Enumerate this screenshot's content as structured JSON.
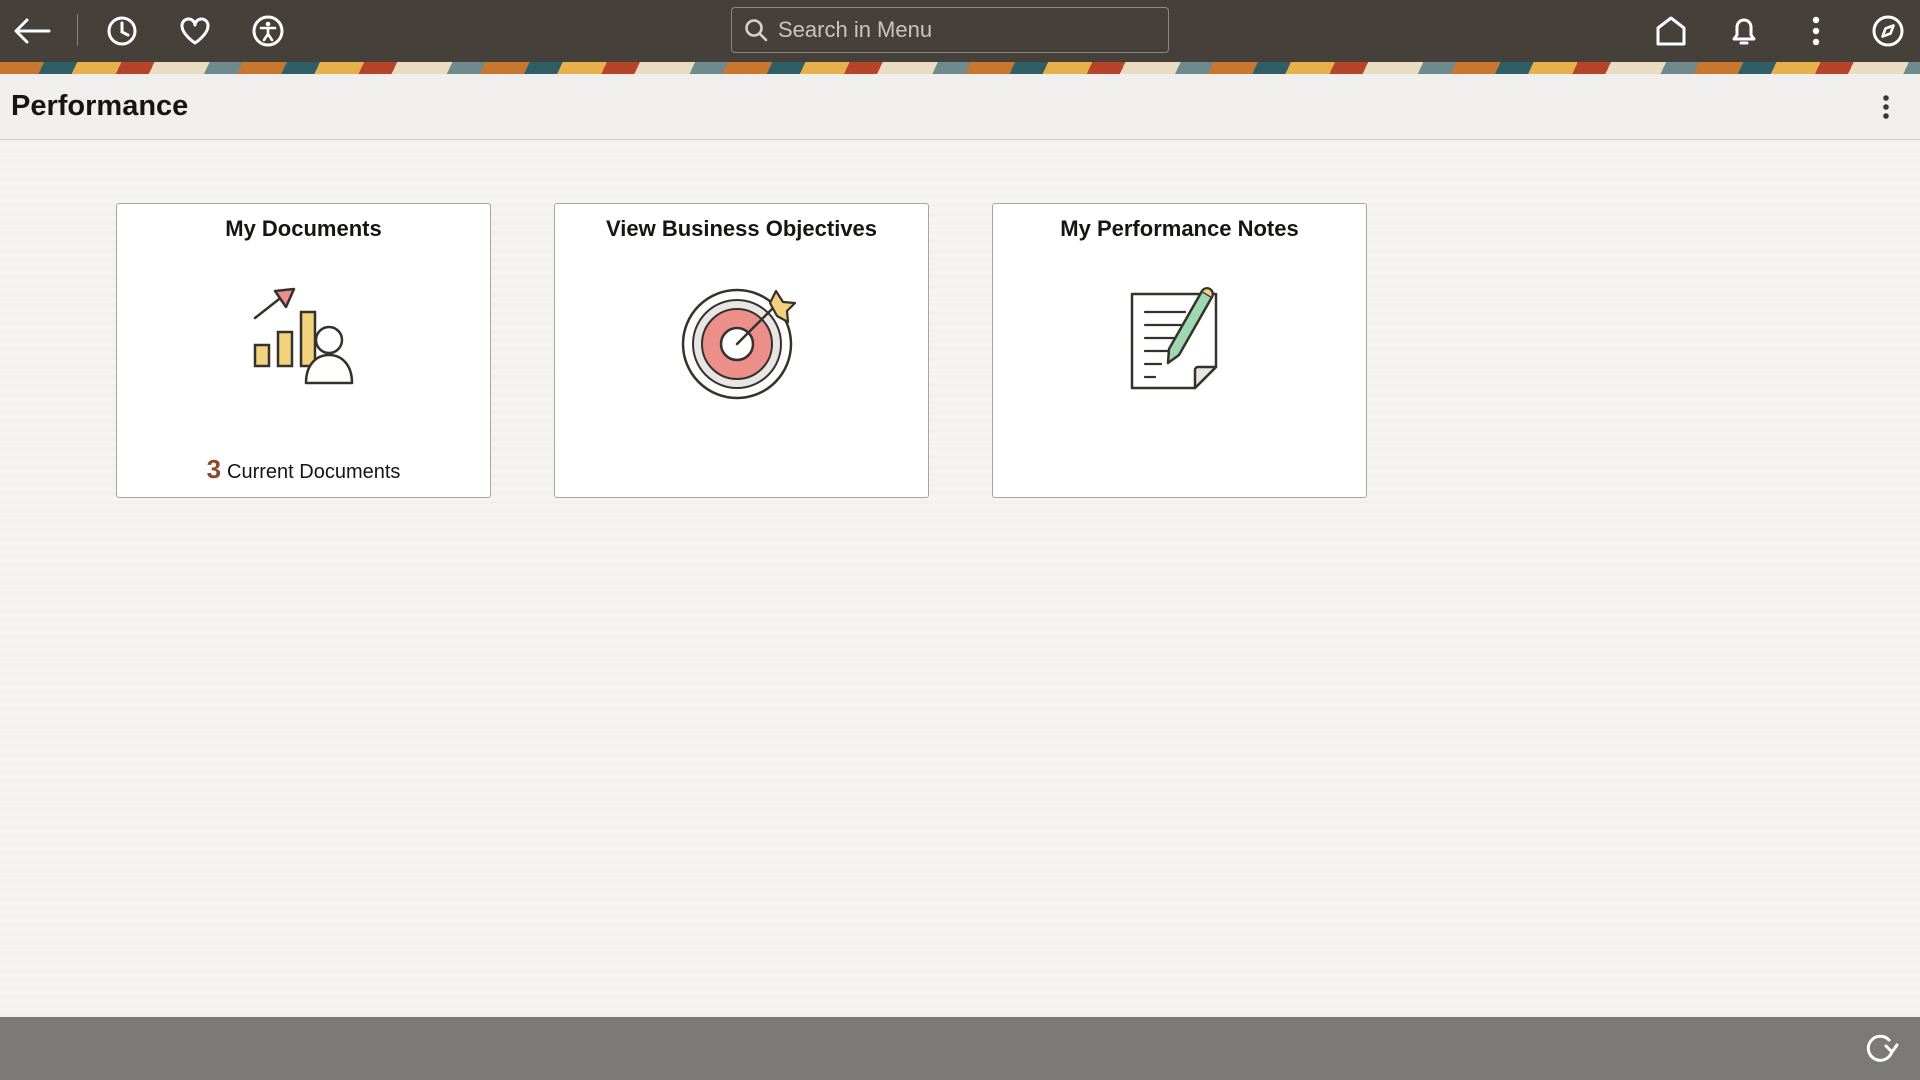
{
  "topbar": {
    "icons": [
      "back-arrow-icon",
      "recent-history-icon",
      "favorites-heart-icon",
      "accessibility-icon",
      "home-icon",
      "notifications-bell-icon",
      "more-actions-icon",
      "navigator-compass-icon"
    ],
    "search": {
      "placeholder": "Search in Menu",
      "value": ""
    }
  },
  "page": {
    "title": "Performance"
  },
  "tiles": [
    {
      "title": "My Documents",
      "count": "3",
      "footer_label": "Current Documents",
      "icon": "performance-chart-person-icon"
    },
    {
      "title": "View Business Objectives",
      "icon": "target-bullseye-icon"
    },
    {
      "title": "My Performance Notes",
      "icon": "notepad-pencil-icon"
    }
  ],
  "colors": {
    "topbar": "#46403b",
    "accent_count": "#8a4a2b",
    "bottombar": "#7b7a79"
  }
}
